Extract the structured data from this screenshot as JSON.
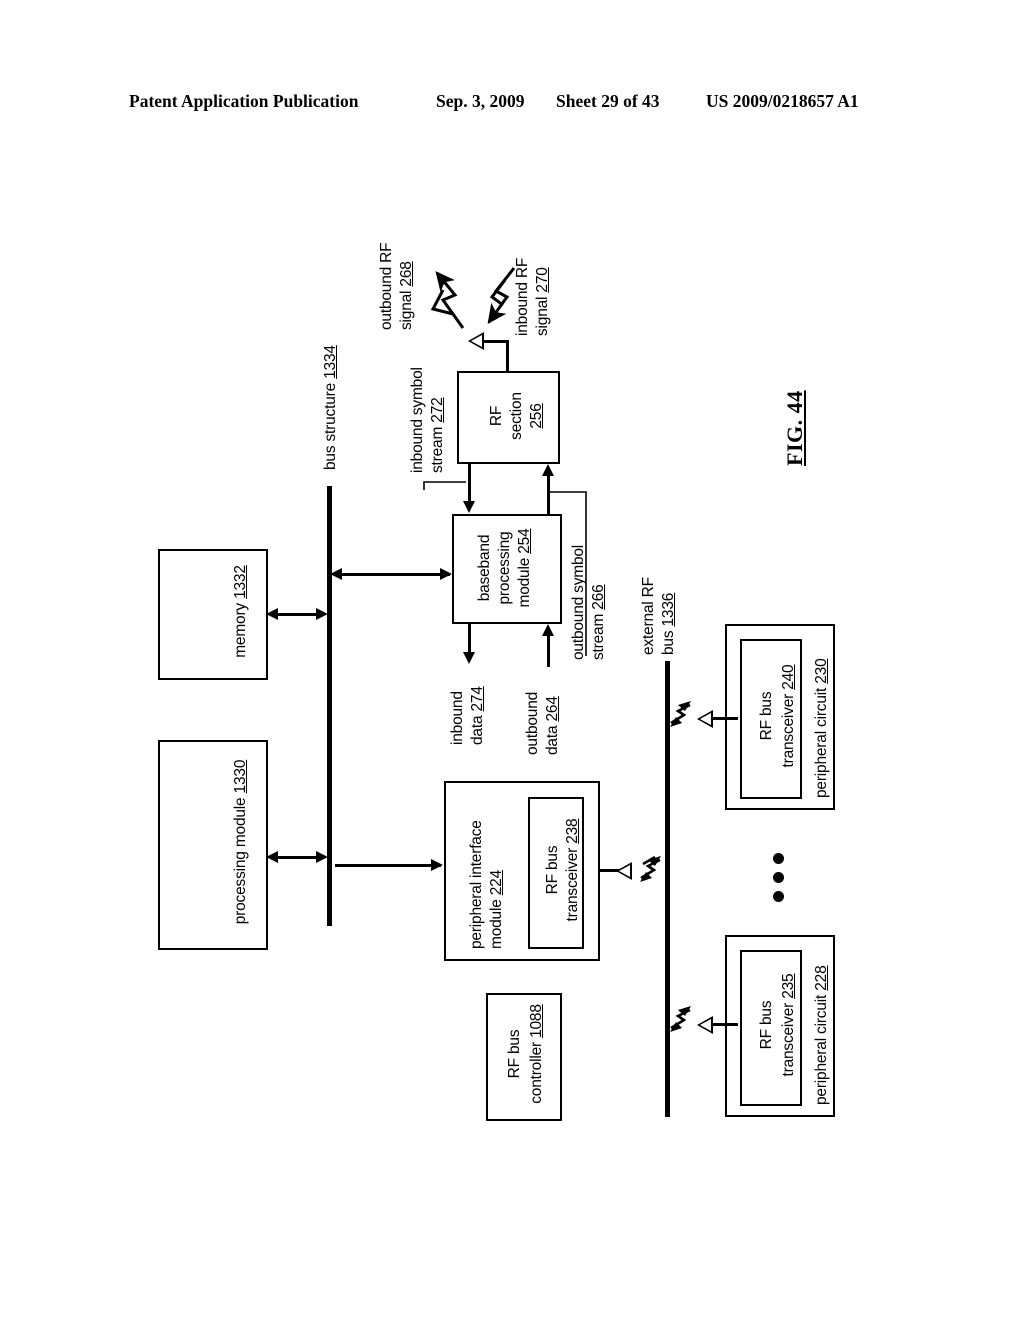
{
  "header": {
    "publication": "Patent Application Publication",
    "date": "Sep. 3, 2009",
    "sheet": "Sheet 29 of 43",
    "patent_number": "US 2009/0218657 A1"
  },
  "figure": {
    "label": "FIG. 44"
  },
  "blocks": {
    "memory": {
      "line1": "memory",
      "ref": "1332"
    },
    "processing_module": {
      "line1": "processing module",
      "ref": "1330"
    },
    "rf_section": {
      "line1": "RF",
      "line2": "section",
      "ref": "256"
    },
    "baseband_processing_module": {
      "line1": "baseband",
      "line2": "processing",
      "line3": "module",
      "ref": "254"
    },
    "peripheral_interface_module": {
      "line1": "peripheral interface",
      "line2": "module",
      "ref": "224"
    },
    "rf_bus_transceiver_238": {
      "line1": "RF bus",
      "line2": "transceiver",
      "ref": "238"
    },
    "rf_bus_controller": {
      "line1": "RF bus",
      "line2": "controller",
      "ref": "1088"
    },
    "peripheral_circuit_230": {
      "line1": "peripheral circuit",
      "ref": "230"
    },
    "rf_bus_transceiver_240": {
      "line1": "RF bus",
      "line2": "transceiver",
      "ref": "240"
    },
    "peripheral_circuit_228": {
      "line1": "peripheral circuit",
      "ref": "228"
    },
    "rf_bus_transceiver_235": {
      "line1": "RF bus",
      "line2": "transceiver",
      "ref": "235"
    }
  },
  "labels": {
    "bus_structure": {
      "line1": "bus structure",
      "ref": "1334"
    },
    "external_rf_bus": {
      "line1": "external RF",
      "line2": "bus",
      "ref": "1336"
    },
    "outbound_rf_signal": {
      "line1": "outbound RF",
      "line2": "signal",
      "ref": "268"
    },
    "inbound_rf_signal": {
      "line1": "inbound RF",
      "line2": "signal",
      "ref": "270"
    },
    "inbound_symbol_stream": {
      "line1": "inbound symbol",
      "line2": "stream",
      "ref": "272"
    },
    "outbound_symbol_stream": {
      "line1": "outbound symbol",
      "line2": "stream",
      "ref": "266"
    },
    "inbound_data": {
      "line1": "inbound",
      "line2": "data",
      "ref": "274"
    },
    "outbound_data": {
      "line1": "outbound",
      "line2": "data",
      "ref": "264"
    }
  },
  "icons": {
    "antenna": "antenna-icon",
    "lightning_outbound": "lightning-bolt-icon",
    "lightning_inbound": "lightning-bolt-icon",
    "ellipsis": "vertical-ellipsis-icon"
  }
}
